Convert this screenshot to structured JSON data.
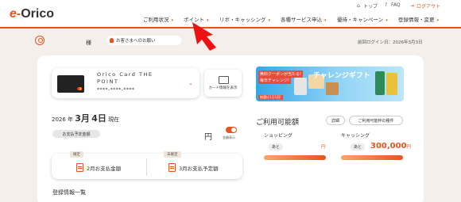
{
  "header": {
    "logo_e": "e-",
    "logo_rest": "Orico",
    "util": [
      {
        "label": "トップ",
        "icon": "home-icon"
      },
      {
        "label": "FAQ",
        "icon": "question-icon"
      },
      {
        "label": "ログアウト",
        "icon": "logout-icon"
      }
    ],
    "nav": [
      {
        "label": "ご利用状況"
      },
      {
        "label": "ポイント"
      },
      {
        "label": "リボ・キャッシング"
      },
      {
        "label": "各種サービス申込"
      },
      {
        "label": "優待・キャンペーン"
      },
      {
        "label": "登録情報・変更"
      }
    ],
    "accent_color": "#e8541e"
  },
  "user": {
    "honorific": "様",
    "notice_label": "お客さまへのお願い",
    "last_login": "前回ログイン日：2026年3月3日"
  },
  "card": {
    "name": "Orico Card THE POINT",
    "number": "****-****-****",
    "info_button": "カード情報を表示"
  },
  "payment": {
    "date_prefix": "2026 年",
    "month": "3月",
    "day": "4日",
    "date_suffix": "現在",
    "scheduled_pill": "お支払予定金額",
    "amount": "",
    "currency": "円",
    "toggle_label": "金額表示",
    "confirmed_badge": "確定",
    "confirmed_label": "2月お支払金額",
    "unconfirmed_badge": "未確定",
    "unconfirmed_label": "3月お支払予定額"
  },
  "registration_title": "登録情報一覧",
  "banner": {
    "line1": "無料クーポンが当たる!",
    "line2": "毎日チャレンジ!",
    "headline": "チャレンジギフト",
    "footer": "抽選は1日1回!"
  },
  "available": {
    "title": "ご利用可能額",
    "detail_button": "詳細",
    "explanation_button": "ご利用可能枠の種件",
    "shopping_label": "ショッピング",
    "shopping_remaining_badge": "あと",
    "shopping_value": "",
    "shopping_unit": "円",
    "cashing_label": "キャッシング",
    "cashing_remaining_badge": "あと",
    "cashing_value": "300,000",
    "cashing_unit": "円",
    "shopping_fill_fraction": 1.0,
    "cashing_fill_fraction": 1.0
  }
}
